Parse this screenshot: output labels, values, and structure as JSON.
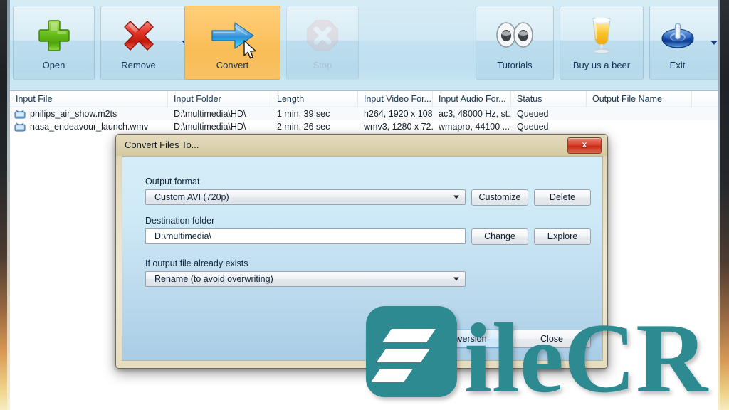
{
  "app": {
    "title": "Convert Files To..."
  },
  "toolbar": {
    "buttons": [
      {
        "label": "Open",
        "icon": "plus-icon",
        "state": "normal",
        "has_dropdown": false
      },
      {
        "label": "Remove",
        "icon": "cross-icon",
        "state": "normal",
        "has_dropdown": true
      },
      {
        "label": "Convert",
        "icon": "arrow-right-icon",
        "state": "active",
        "has_dropdown": false
      },
      {
        "label": "Stop",
        "icon": "stop-octagon-icon",
        "state": "disabled",
        "has_dropdown": false
      },
      {
        "label": "Tutorials",
        "icon": "eyes-icon",
        "state": "normal",
        "has_dropdown": false
      },
      {
        "label": "Buy us a beer",
        "icon": "beer-glass-icon",
        "state": "normal",
        "has_dropdown": false
      },
      {
        "label": "Exit",
        "icon": "power-icon",
        "state": "normal",
        "has_dropdown": true
      }
    ],
    "active_color": "#f9bd56"
  },
  "file_list": {
    "columns": [
      "Input File",
      "Input Folder",
      "Length",
      "Input Video For...",
      "Input Audio For...",
      "Status",
      "Output File Name"
    ],
    "rows": [
      {
        "icon": "tv-icon",
        "input_file": "philips_air_show.m2ts",
        "input_folder": "D:\\multimedia\\HD\\",
        "length": "1 min, 39 sec",
        "input_video_format": "h264,  1920 x 108...",
        "input_audio_format": "ac3,  48000 Hz, st...",
        "status": "Queued",
        "output_file_name": ""
      },
      {
        "icon": "tv-icon",
        "input_file": "nasa_endeavour_launch.wmv",
        "input_folder": "D:\\multimedia\\HD\\",
        "length": "2 min, 26 sec",
        "input_video_format": "wmv3,  1280 x 72...",
        "input_audio_format": "wmapro,  44100 ...",
        "status": "Queued",
        "output_file_name": ""
      }
    ]
  },
  "dialog": {
    "title": "Convert Files To...",
    "close_label": "x",
    "output_format": {
      "label": "Output format",
      "value": "Custom  AVI  (720p)",
      "customize_label": "Customize",
      "delete_label": "Delete"
    },
    "destination": {
      "label": "Destination folder",
      "value": "D:\\multimedia\\",
      "change_label": "Change",
      "explore_label": "Explore"
    },
    "exists": {
      "label": "If output file already exists",
      "value": "Rename  (to avoid overwriting)"
    },
    "actions": {
      "start_label": "Start Conversion",
      "close_label": "Close"
    }
  },
  "watermark": {
    "text": "ileCR",
    "color": "#2e8a91"
  }
}
